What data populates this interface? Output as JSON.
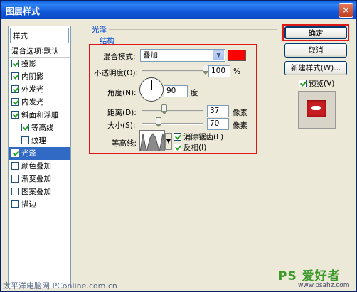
{
  "window": {
    "title": "图层样式",
    "close_glyph": "×"
  },
  "style_list": {
    "header": "样式",
    "blend_default": "混合选项:默认",
    "items": [
      {
        "label": "投影",
        "checked": true,
        "sub": false
      },
      {
        "label": "内阴影",
        "checked": true,
        "sub": false
      },
      {
        "label": "外发光",
        "checked": true,
        "sub": false
      },
      {
        "label": "内发光",
        "checked": true,
        "sub": false
      },
      {
        "label": "斜面和浮雕",
        "checked": true,
        "sub": false
      },
      {
        "label": "等高线",
        "checked": true,
        "sub": true
      },
      {
        "label": "纹理",
        "checked": false,
        "sub": true
      },
      {
        "label": "光泽",
        "checked": true,
        "sub": false,
        "selected": true
      },
      {
        "label": "颜色叠加",
        "checked": false,
        "sub": false
      },
      {
        "label": "渐变叠加",
        "checked": false,
        "sub": false
      },
      {
        "label": "图案叠加",
        "checked": false,
        "sub": false
      },
      {
        "label": "描边",
        "checked": false,
        "sub": false
      }
    ]
  },
  "panel": {
    "group_title": "光泽",
    "structure_title": "结构",
    "blend_mode_label": "混合模式:",
    "blend_mode_value": "叠加",
    "blend_color": "#ff0000",
    "opacity_label": "不透明度(O):",
    "opacity_value": "100",
    "opacity_unit": "%",
    "opacity_level": 1.0,
    "angle_label": "角度(N):",
    "angle_value": "90",
    "angle_unit": "度",
    "distance_label": "距离(D):",
    "distance_value": "37",
    "distance_unit": "像素",
    "distance_level": 0.37,
    "size_label": "大小(S):",
    "size_value": "70",
    "size_unit": "像素",
    "size_level": 0.28,
    "contour_label": "等高线:",
    "anti_alias_label": "消除锯齿(L)",
    "anti_alias_checked": true,
    "invert_label": "反相(I)",
    "invert_checked": true
  },
  "buttons": {
    "ok": "确定",
    "cancel": "取消",
    "new_style": "新建样式(W)...",
    "preview_label": "预览(V)",
    "preview_checked": true
  },
  "watermarks": {
    "left": "太平洋电脑网 PConline.com.cn",
    "brand": "PS 爱好者",
    "site": "www.psahz.com"
  },
  "colors": {
    "highlight_red": "#e01818",
    "selection_blue": "#316ac5",
    "title_blue": "#0a5ee0"
  }
}
